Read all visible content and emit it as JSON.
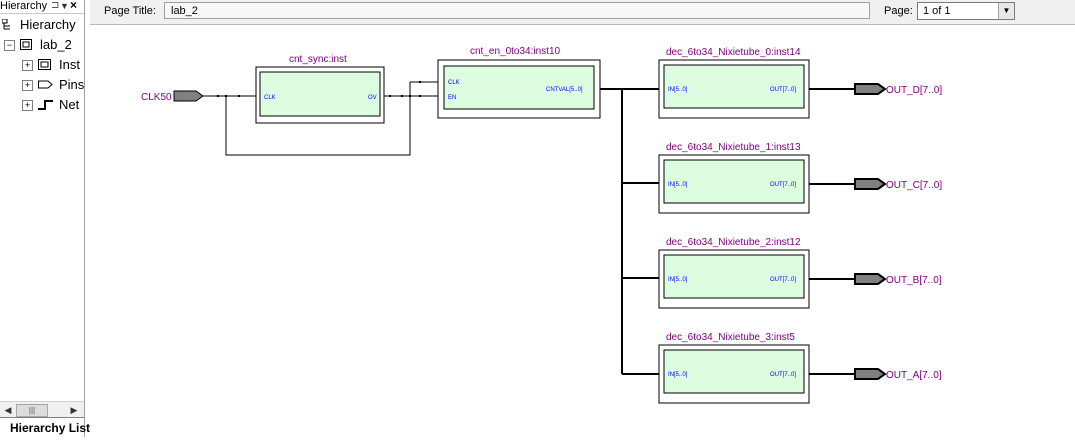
{
  "left_pane": {
    "title": "Hierarchy",
    "pin_glyph": "⊐",
    "dropdown_glyph": "▼",
    "close_glyph": "×",
    "tree_root": "Hierarchy",
    "project": "lab_2",
    "children": [
      "Inst",
      "Pins",
      "Net"
    ],
    "bottom_tab": "Hierarchy List"
  },
  "toolbar": {
    "page_title_label": "Page Title:",
    "page_title_value": "lab_2",
    "page_label": "Page:",
    "page_value": "1 of 1"
  },
  "schematic": {
    "input_pin": "CLK50",
    "sync_block": {
      "name": "cnt_sync:inst",
      "port_in": "CLK",
      "port_out": "OV"
    },
    "counter_block": {
      "name": "cnt_en_0to34:inst10",
      "port_clk": "CLK",
      "port_en": "EN",
      "port_out": "CNTVAL[5..0]"
    },
    "decoders": [
      {
        "name": "dec_6to34_Nixietube_0:inst14",
        "in": "IN[5..0]",
        "out": "OUT[7..0]",
        "output_pin": "OUT_D[7..0]"
      },
      {
        "name": "dec_6to34_Nixietube_1:inst13",
        "in": "IN[5..0]",
        "out": "OUT[7..0]",
        "output_pin": "OUT_C[7..0]"
      },
      {
        "name": "dec_6to34_Nixietube_2:inst12",
        "in": "IN[5..0]",
        "out": "OUT[7..0]",
        "output_pin": "OUT_B[7..0]"
      },
      {
        "name": "dec_6to34_Nixietube_3:inst5",
        "in": "IN[5..0]",
        "out": "OUT[7..0]",
        "output_pin": "OUT_A[7..0]"
      }
    ],
    "colors": {
      "block_fill": "#ddfde0",
      "label": "#800080",
      "port_text": "#0000ff",
      "wire": "#000000",
      "pin_fill": "#808080"
    }
  }
}
